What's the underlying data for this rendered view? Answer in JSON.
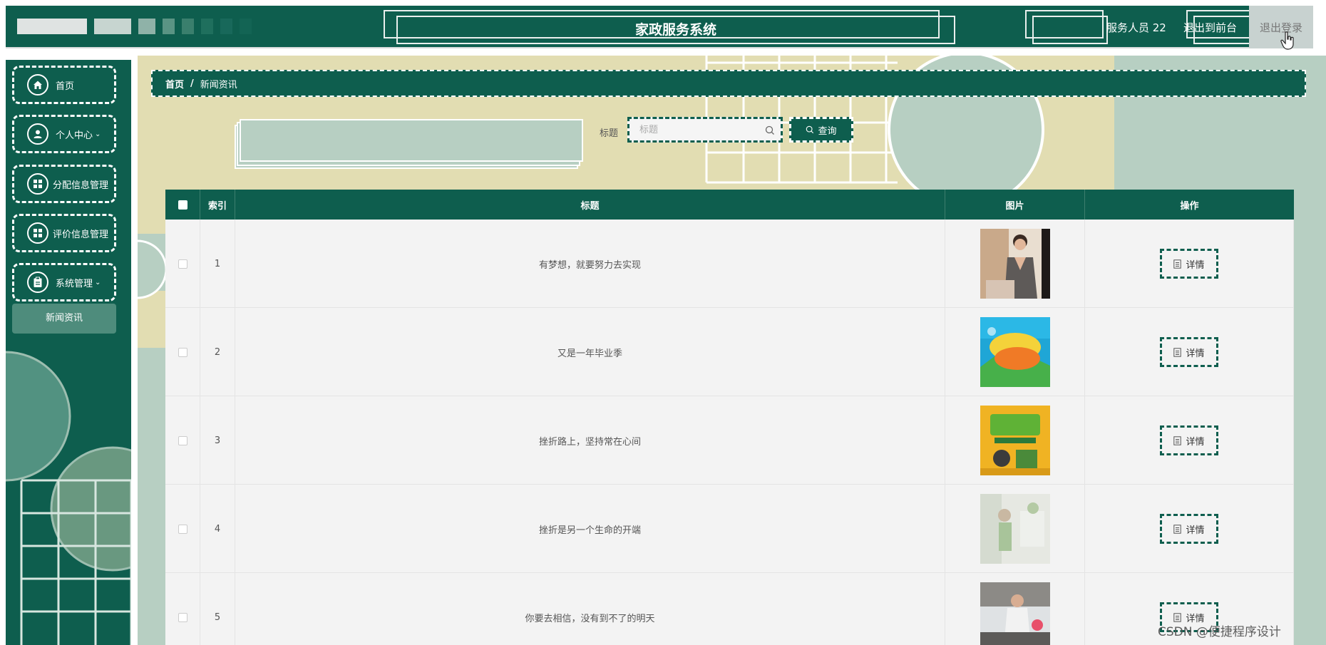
{
  "header": {
    "title": "家政服务系统",
    "user_label": "服务人员 22",
    "front_link": "退出到前台",
    "logout_link": "退出登录"
  },
  "sidebar": {
    "items": [
      {
        "label": "首页",
        "icon": "home-icon"
      },
      {
        "label": "个人中心",
        "icon": "user-icon",
        "chevron": "⌄"
      },
      {
        "label": "分配信息管理",
        "icon": "grid-icon"
      },
      {
        "label": "评价信息管理",
        "icon": "grid-icon"
      },
      {
        "label": "系统管理",
        "icon": "clipboard-icon",
        "chevron": "⌄"
      }
    ],
    "submenu": {
      "label": "新闻资讯"
    }
  },
  "breadcrumb": {
    "home": "首页",
    "separator": "/",
    "current": "新闻资讯"
  },
  "search": {
    "label": "标题",
    "placeholder": "标题",
    "button": "查询"
  },
  "table": {
    "headers": {
      "index": "索引",
      "title": "标题",
      "image": "图片",
      "actions": "操作"
    },
    "rows": [
      {
        "index": "1",
        "title": "有梦想，就要努力去实现",
        "image": "housekeeper-photo",
        "action": "详情"
      },
      {
        "index": "2",
        "title": "又是一年毕业季",
        "image": "housekeeping-service-banner",
        "action": "详情"
      },
      {
        "index": "3",
        "title": "挫折路上，坚持常在心间",
        "image": "housekeeping-service-poster",
        "action": "详情"
      },
      {
        "index": "4",
        "title": "挫折是另一个生命的开端",
        "image": "blurred-cleaning-photo",
        "action": "详情"
      },
      {
        "index": "5",
        "title": "你要去相信，没有到不了的明天",
        "image": "kitchen-cleaning-photo",
        "action": "详情"
      }
    ]
  },
  "watermark": "CSDN @便捷程序设计",
  "colors": {
    "primary": "#0e5e4e",
    "background": "#e2ddb2",
    "light_green": "#b7cfc2",
    "table_bg": "#f3f3f3"
  }
}
